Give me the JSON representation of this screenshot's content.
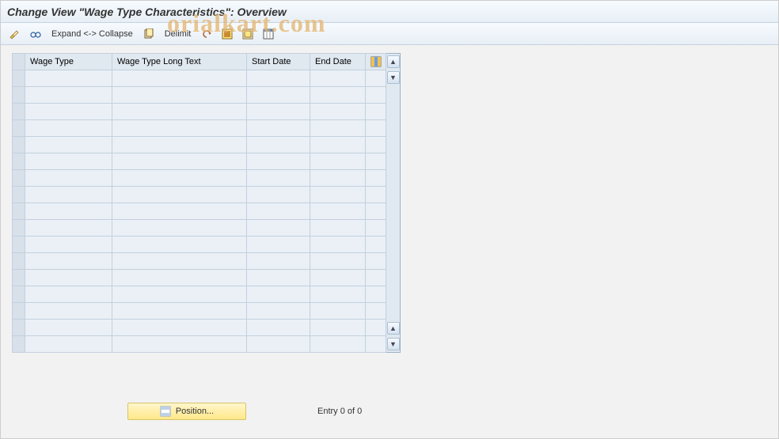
{
  "title": "Change View \"Wage Type Characteristics\": Overview",
  "watermark": "orialkart.com",
  "toolbar": {
    "expand_collapse": "Expand <-> Collapse",
    "delimit": "Delimit"
  },
  "columns": {
    "c0": "",
    "c1": "Wage Type",
    "c2": "Wage Type Long Text",
    "c3": "Start Date",
    "c4": "End Date",
    "cfg": ""
  },
  "footer": {
    "position": "Position...",
    "status": "Entry 0 of 0"
  }
}
